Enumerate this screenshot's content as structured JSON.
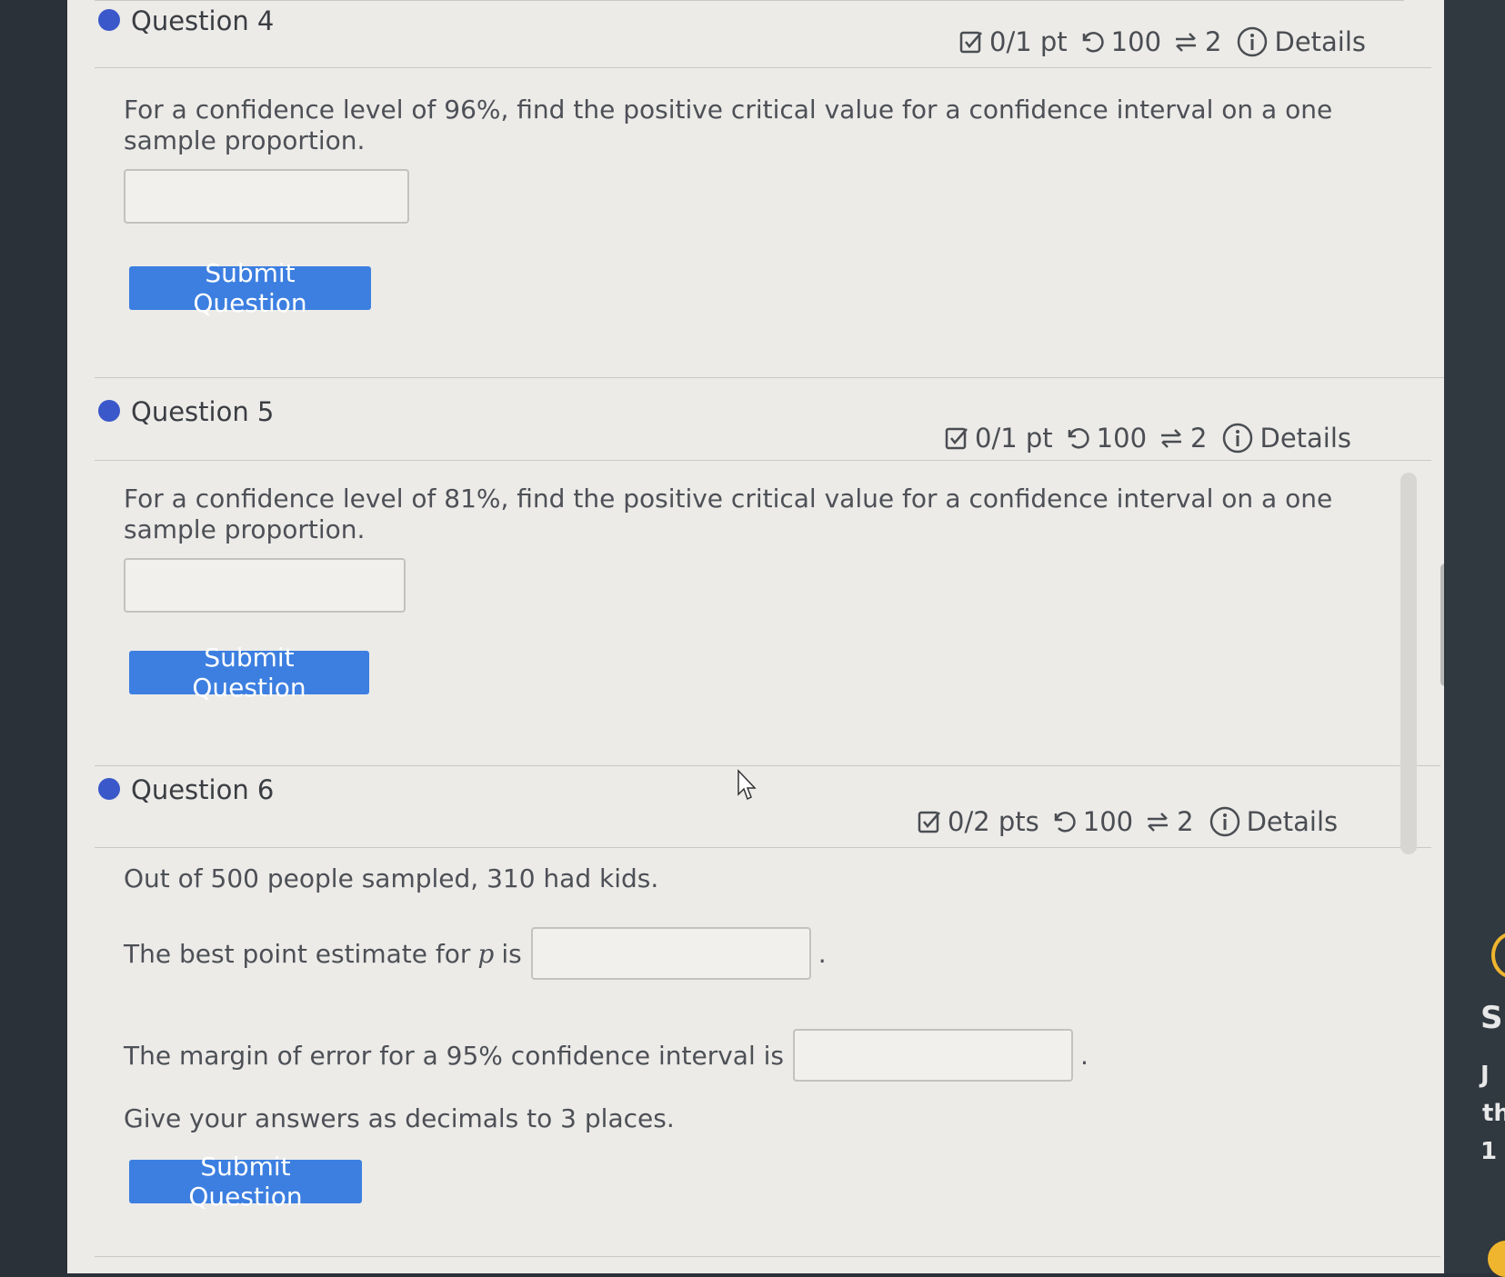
{
  "questions": [
    {
      "title": "Question 4",
      "points": "0/1 pt",
      "retries": "100",
      "attempts": "2",
      "details_label": "Details",
      "prompt_line1": "For a confidence level of 96%, find the positive critical value for a confidence interval on a one",
      "prompt_line2": "sample proportion.",
      "answer_value": "",
      "submit_label": "Submit Question"
    },
    {
      "title": "Question 5",
      "points": "0/1 pt",
      "retries": "100",
      "attempts": "2",
      "details_label": "Details",
      "prompt_line1": "For a confidence level of 81%, find the positive critical value for a confidence interval on a one",
      "prompt_line2": "sample proportion.",
      "answer_value": "",
      "submit_label": "Submit Question"
    },
    {
      "title": "Question 6",
      "points": "0/2 pts",
      "retries": "100",
      "attempts": "2",
      "details_label": "Details",
      "intro": "Out of 500 people sampled, 310 had kids.",
      "point_estimate_before": "The best point estimate for",
      "point_estimate_var": "p",
      "point_estimate_after": "is",
      "margin_label": "The margin of error for a 95% confidence interval is",
      "period": ".",
      "instructions": "Give your answers as decimals to 3 places.",
      "submit_label": "Submit Question"
    }
  ],
  "edge_fragments": [
    "S",
    "J",
    "th",
    "1"
  ],
  "colors": {
    "accent": "#3a58c9",
    "button": "#3c7fe0",
    "page_bg": "#ecebe8"
  },
  "icons": [
    "checkbox-icon",
    "retry-icon",
    "attempts-icon",
    "info-icon"
  ]
}
